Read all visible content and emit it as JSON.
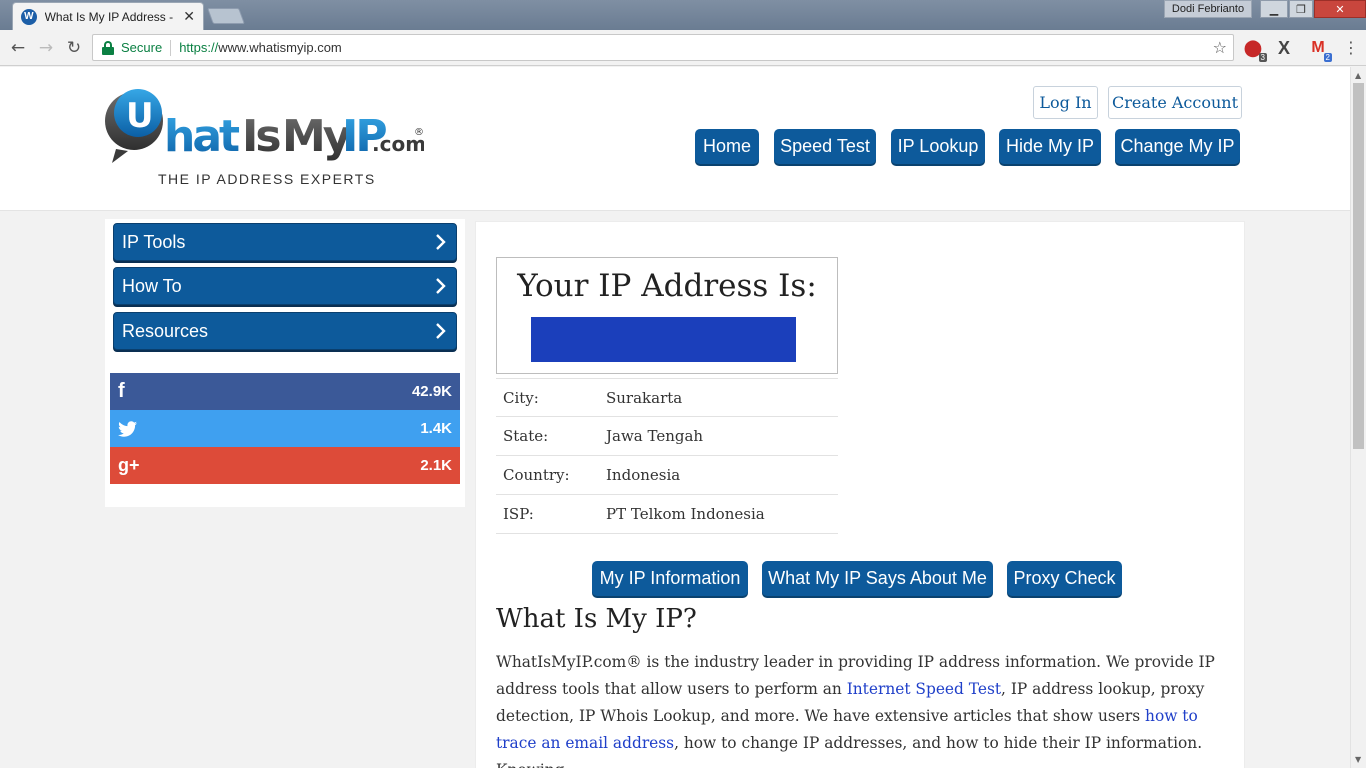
{
  "browser": {
    "tab_title": "What Is My IP Address - ",
    "tab_favicon_letter": "W",
    "user_name": "Dodi Febrianto",
    "security_label": "Secure",
    "url_scheme": "https://",
    "url_host": "www.whatismyip.com",
    "extensions": [
      {
        "name": "adblock",
        "badge": "3"
      },
      {
        "name": "x-extension",
        "badge": ""
      },
      {
        "name": "gmail",
        "badge": "2"
      }
    ]
  },
  "header": {
    "logo_text": "WhatIsMyIP.com",
    "logo_reg": "®",
    "tagline": "THE IP ADDRESS EXPERTS",
    "account": {
      "login": "Log In",
      "create": "Create Account"
    },
    "nav": [
      "Home",
      "Speed Test",
      "IP Lookup",
      "Hide My IP",
      "Change My IP"
    ]
  },
  "sidebar": {
    "links": [
      "IP Tools",
      "How To",
      "Resources"
    ],
    "shares": [
      {
        "network": "facebook",
        "icon": "f",
        "count": "42.9K",
        "color": "#3b5998"
      },
      {
        "network": "twitter",
        "icon": "",
        "count": "1.4K",
        "color": "#3fa0f0"
      },
      {
        "network": "googleplus",
        "icon": "g+",
        "count": "2.1K",
        "color": "#dd4b39"
      }
    ]
  },
  "main": {
    "ip_heading": "Your IP Address Is:",
    "info_rows": [
      {
        "label": "City:",
        "value": "Surakarta"
      },
      {
        "label": "State:",
        "value": "Jawa Tengah"
      },
      {
        "label": "Country:",
        "value": "Indonesia"
      },
      {
        "label": "ISP:",
        "value": "PT Telkom Indonesia"
      }
    ],
    "actions": [
      "My IP Information",
      "What My IP Says About Me",
      "Proxy Check"
    ],
    "section_title": "What Is My IP?",
    "paragraph": {
      "p1": "WhatIsMyIP.com® is the industry leader in providing IP address information. We provide IP address tools that allow users to perform an ",
      "link1": "Internet Speed Test",
      "p2": ", IP address lookup, proxy detection, IP Whois Lookup, and more. We have extensive articles that show users ",
      "link2": "how to trace an email address",
      "p3": ", how to change IP addresses, and how to hide their IP information. Knowing"
    }
  },
  "colors": {
    "brand_blue": "#0d5a9b",
    "link_blue": "#1f3fc9",
    "ip_redaction": "#1b3fbb"
  }
}
